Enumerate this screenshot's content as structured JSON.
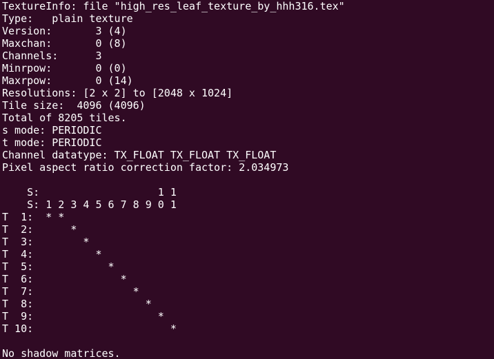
{
  "terminal": {
    "background": "#300a24",
    "foreground": "#ffffff",
    "lines": [
      "TextureInfo: file \"high_res_leaf_texture_by_hhh316.tex\"",
      "Type:   plain texture",
      "Version:       3 (4)",
      "Maxchan:       0 (8)",
      "Channels:      3",
      "Minrpow:       0 (0)",
      "Maxrpow:       0 (14)",
      "Resolutions: [2 x 2] to [2048 x 1024]",
      "Tile size:  4096 (4096)",
      "Total of 8205 tiles.",
      "s mode: PERIODIC",
      "t mode: PERIODIC",
      "Channel datatype: TX_FLOAT TX_FLOAT TX_FLOAT",
      "Pixel aspect ratio correction factor: 2.034973",
      "",
      "    S:                   1 1",
      "    S: 1 2 3 4 5 6 7 8 9 0 1",
      "T  1:  * *",
      "T  2:      *",
      "T  3:        *",
      "T  4:          *",
      "T  5:            *",
      "T  6:              *",
      "T  7:                *",
      "T  8:                  *",
      "T  9:                    *",
      "T 10:                      *",
      "",
      "No shadow matrices."
    ]
  }
}
